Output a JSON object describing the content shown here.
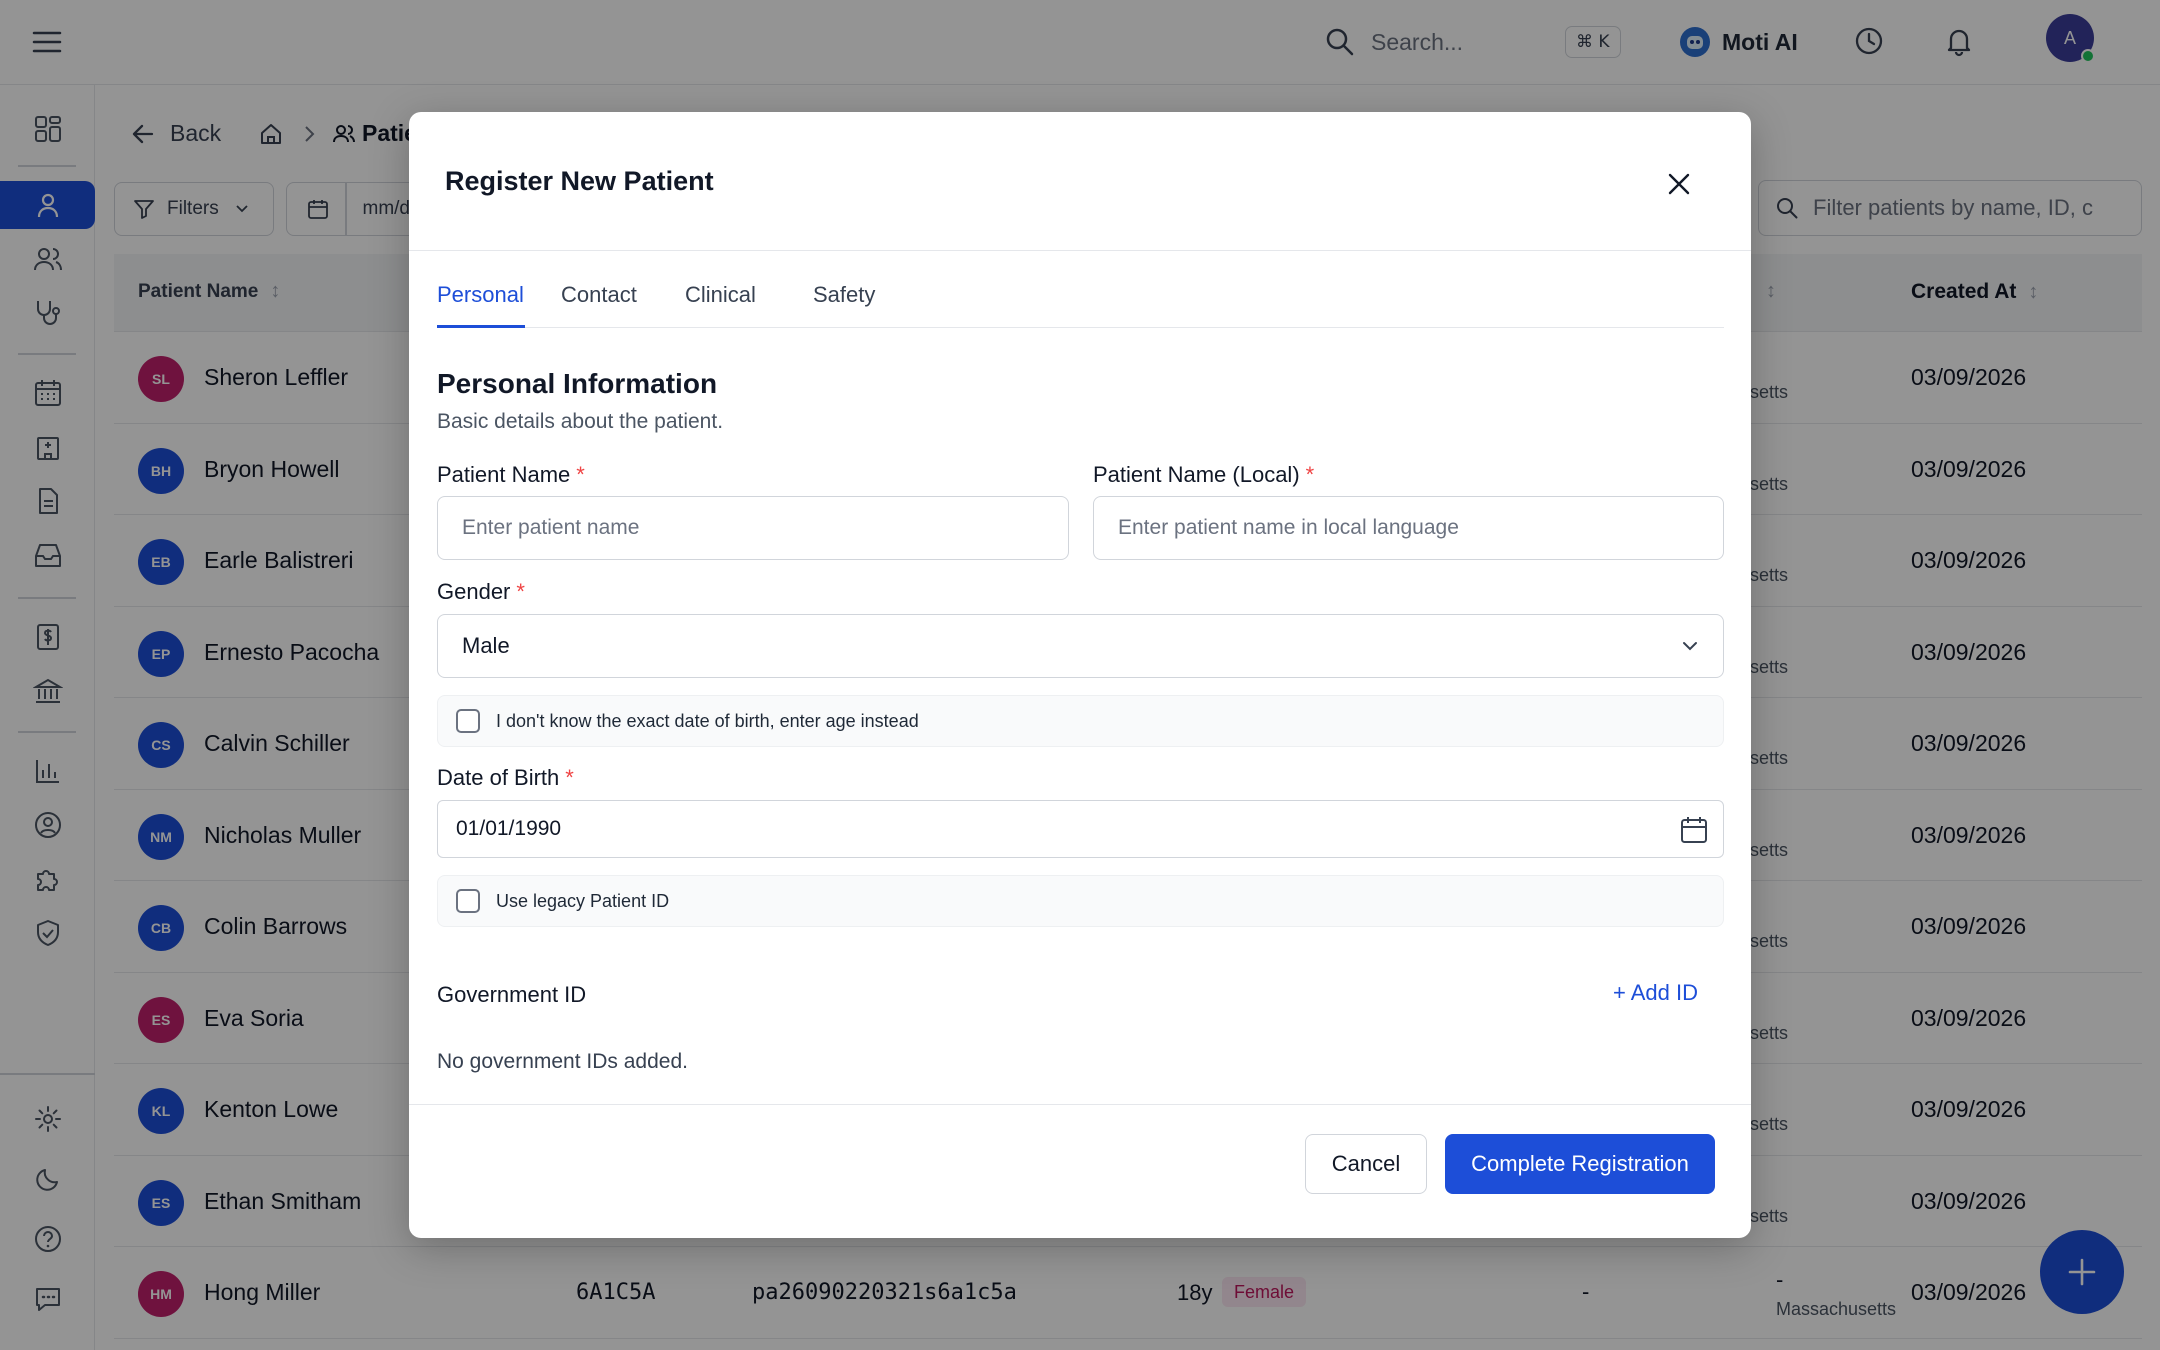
{
  "topbar": {
    "search_placeholder": "Search...",
    "shortcut": "⌘ K",
    "assistant_name": "Moti AI",
    "avatar_initial": "A"
  },
  "page": {
    "back_label": "Back",
    "breadcrumb_current": "Patie",
    "filters_label": "Filters",
    "date_placeholder": "mm/d",
    "filter_search_placeholder": "Filter patients by name, ID, c"
  },
  "table": {
    "headers": {
      "patient_name": "Patient Name",
      "created_at": "Created At"
    },
    "rows": [
      {
        "initials": "SL",
        "name": "Sheron Leffler",
        "state": "setts",
        "created": "03/09/2026",
        "color": "#c0206c"
      },
      {
        "initials": "BH",
        "name": "Bryon Howell",
        "state": "setts",
        "created": "03/09/2026",
        "color": "#1d4ed8"
      },
      {
        "initials": "EB",
        "name": "Earle Balistreri",
        "state": "setts",
        "created": "03/09/2026",
        "color": "#1d4ed8"
      },
      {
        "initials": "EP",
        "name": "Ernesto Pacocha",
        "state": "setts",
        "created": "03/09/2026",
        "color": "#1d4ed8"
      },
      {
        "initials": "CS",
        "name": "Calvin Schiller",
        "state": "setts",
        "created": "03/09/2026",
        "color": "#1d4ed8"
      },
      {
        "initials": "NM",
        "name": "Nicholas Muller",
        "state": "setts",
        "created": "03/09/2026",
        "color": "#1d4ed8"
      },
      {
        "initials": "CB",
        "name": "Colin Barrows",
        "state": "setts",
        "created": "03/09/2026",
        "color": "#1d4ed8"
      },
      {
        "initials": "ES",
        "name": "Eva Soria",
        "state": "setts",
        "created": "03/09/2026",
        "color": "#c0206c"
      },
      {
        "initials": "KL",
        "name": "Kenton Lowe",
        "state": "setts",
        "created": "03/09/2026",
        "color": "#1d4ed8"
      },
      {
        "initials": "ES",
        "name": "Ethan Smitham",
        "state": "setts",
        "created": "03/09/2026",
        "color": "#1d4ed8"
      },
      {
        "initials": "HM",
        "name": "Hong Miller",
        "state": "Massachusetts",
        "created": "03/09/2026",
        "color": "#c0206c",
        "id_code": "6A1C5A",
        "patient_id": "pa26090220321s6a1c5a",
        "age": "18y",
        "gender": "Female",
        "dash1": "-",
        "dash2": "-"
      }
    ]
  },
  "modal": {
    "title": "Register New Patient",
    "tabs": [
      "Personal",
      "Contact",
      "Clinical",
      "Safety"
    ],
    "section_title": "Personal Information",
    "section_subtitle": "Basic details about the patient.",
    "patient_name_label": "Patient Name",
    "patient_name_placeholder": "Enter patient name",
    "patient_name_local_label": "Patient Name (Local)",
    "patient_name_local_placeholder": "Enter patient name in local language",
    "required_mark": "*",
    "gender_label": "Gender",
    "gender_value": "Male",
    "age_instead_label": "I don't know the exact date of birth, enter age instead",
    "dob_label": "Date of Birth",
    "dob_value": "01/01/1990",
    "legacy_id_label": "Use legacy Patient ID",
    "gov_id_title": "Government ID",
    "add_id_label": "+ Add ID",
    "gov_id_empty": "No government IDs added.",
    "cancel_label": "Cancel",
    "submit_label": "Complete Registration"
  },
  "colors": {
    "primary": "#1d4ed8",
    "required": "#ef4444",
    "female_badge_bg": "#fce7f3",
    "female_badge_fg": "#be185d"
  }
}
